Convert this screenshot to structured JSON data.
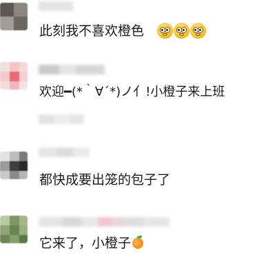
{
  "messages": [
    {
      "text": "此刻我不喜欢橙色"
    },
    {
      "text": "欢迎━(*｀∀´*)ノ亻!小橙子来上班"
    },
    {
      "text": "都快成要出笼的包子了"
    },
    {
      "text": "它来了，小橙子"
    }
  ],
  "icons": {
    "emoji": "flushed-face-icon",
    "orange": "tangerine-icon"
  }
}
